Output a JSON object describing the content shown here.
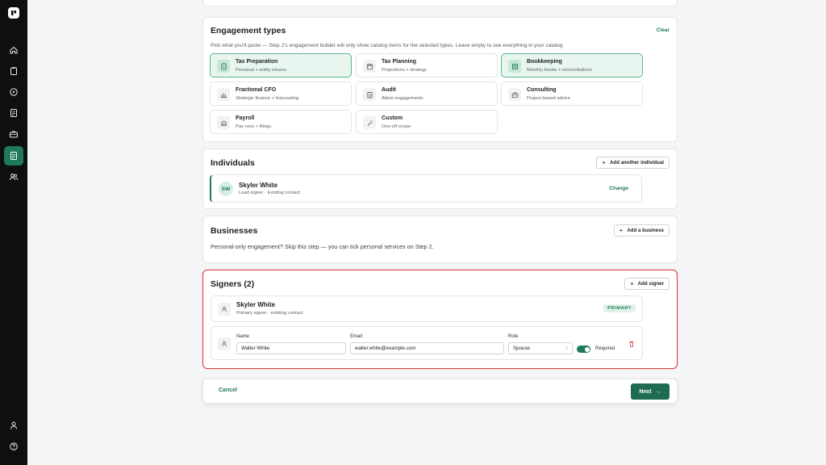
{
  "engagement": {
    "title": "Engagement types",
    "clear_label": "Clear",
    "description": "Pick what you'll quote — Step 2's engagement builder will only show catalog items for the selected types. Leave empty to see everything in your catalog.",
    "types": [
      {
        "title": "Tax Preparation",
        "sub": "Personal + entity returns",
        "selected": true,
        "icon": "document-dollar-icon"
      },
      {
        "title": "Tax Planning",
        "sub": "Projections + strategy",
        "selected": false,
        "icon": "calendar-icon"
      },
      {
        "title": "Bookkeeping",
        "sub": "Monthly books + reconciliations",
        "selected": true,
        "icon": "ledger-icon"
      },
      {
        "title": "Fractional CFO",
        "sub": "Strategic finance + forecasting",
        "selected": false,
        "icon": "bar-chart-icon"
      },
      {
        "title": "Audit",
        "sub": "Attest engagements",
        "selected": false,
        "icon": "clipboard-icon"
      },
      {
        "title": "Consulting",
        "sub": "Project-based advice",
        "selected": false,
        "icon": "briefcase-icon"
      },
      {
        "title": "Payroll",
        "sub": "Pay runs + filings",
        "selected": false,
        "icon": "building-icon"
      },
      {
        "title": "Custom",
        "sub": "One-off scope",
        "selected": false,
        "icon": "magic-wand-icon"
      }
    ]
  },
  "individuals": {
    "title": "Individuals",
    "add_label": "Add another individual",
    "person": {
      "initials": "SW",
      "name": "Skyler White",
      "meta": "Lead signer · Existing contact",
      "change_label": "Change"
    }
  },
  "businesses": {
    "title": "Businesses",
    "add_label": "Add a business",
    "description": "Personal-only engagement? Skip this step — you can tick personal services on Step 2."
  },
  "signers": {
    "title": "Signers (2)",
    "add_label": "Add signer",
    "primary": {
      "name": "Skyler White",
      "meta": "Primary signer · existing contact",
      "badge": "PRIMARY"
    },
    "form": {
      "name_label": "Name",
      "name_value": "Walter White",
      "email_label": "Email",
      "email_value": "walter.white@example.com",
      "role_label": "Role",
      "role_value": "Spouse",
      "required_label": "Required",
      "required_on": true
    }
  },
  "footer": {
    "cancel_label": "Cancel",
    "next_label": "Next"
  },
  "colors": {
    "accent": "#1f7a5a",
    "highlight": "#d93b3b",
    "selected_bg": "#e8f6ef"
  }
}
